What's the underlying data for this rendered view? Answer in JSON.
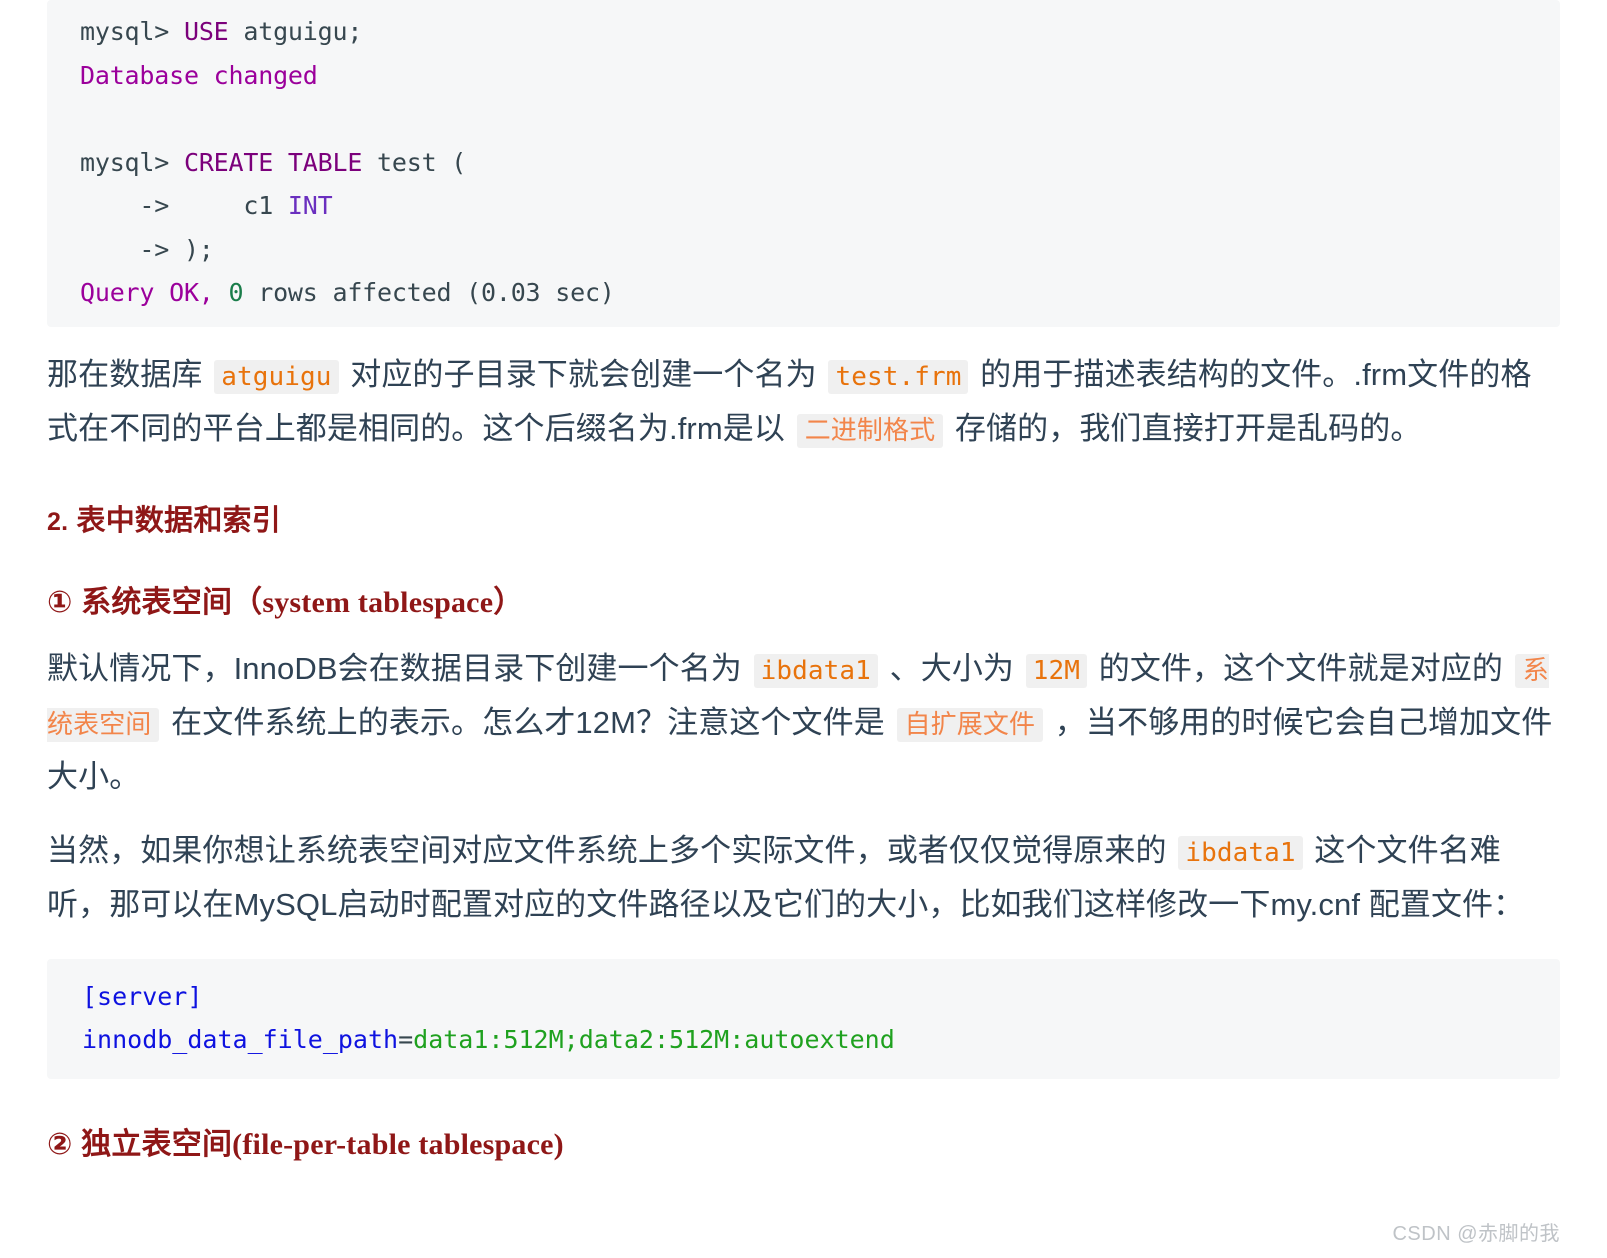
{
  "code_block_sql": {
    "lines": [
      [
        {
          "t": "mysql> ",
          "c": "prompt"
        },
        {
          "t": "USE",
          "c": "kw"
        },
        {
          "t": " atguigu;",
          "c": "plain"
        }
      ],
      [
        {
          "t": "Database changed",
          "c": "magenta"
        }
      ],
      [
        {
          "t": "",
          "c": "plain"
        }
      ],
      [
        {
          "t": "mysql> ",
          "c": "prompt"
        },
        {
          "t": "CREATE TABLE",
          "c": "kw"
        },
        {
          "t": " test (",
          "c": "plain"
        }
      ],
      [
        {
          "t": "    ->     c1 ",
          "c": "plain"
        },
        {
          "t": "INT",
          "c": "type"
        }
      ],
      [
        {
          "t": "    -> );",
          "c": "plain"
        }
      ],
      [
        {
          "t": "Query OK, ",
          "c": "magenta"
        },
        {
          "t": "0",
          "c": "num"
        },
        {
          "t": " rows affected (0.03 sec)",
          "c": "plain"
        }
      ]
    ]
  },
  "paragraph_frm": {
    "segments": [
      {
        "t": "那在数据库 ",
        "k": "text"
      },
      {
        "t": "atguigu",
        "k": "code"
      },
      {
        "t": " 对应的子目录下就会创建一个名为 ",
        "k": "text"
      },
      {
        "t": "test.frm",
        "k": "code"
      },
      {
        "t": " 的用于描述表结构的文件。.frm文件的格式在不同的平台上都是相同的。这个后缀名为.frm是以 ",
        "k": "text"
      },
      {
        "t": "二进制格式",
        "k": "code-cjk"
      },
      {
        "t": " 存储的，我们直接打开是乱码的。",
        "k": "text"
      }
    ]
  },
  "heading_section": {
    "num": "2.",
    "title": "表中数据和索引"
  },
  "heading_sub1": {
    "marker": "①",
    "cn": "系统表空间",
    "en": "（system tablespace）"
  },
  "paragraph_sys_tablespace": {
    "segments": [
      {
        "t": "默认情况下，InnoDB会在数据目录下创建一个名为 ",
        "k": "text"
      },
      {
        "t": "ibdata1",
        "k": "code"
      },
      {
        "t": " 、大小为 ",
        "k": "text"
      },
      {
        "t": "12M",
        "k": "code"
      },
      {
        "t": " 的文件，这个文件就是对应的 ",
        "k": "text"
      },
      {
        "t": "系统表空间",
        "k": "code-cjk"
      },
      {
        "t": " 在文件系统上的表示。怎么才12M？注意这个文件是 ",
        "k": "text"
      },
      {
        "t": "自扩展文件",
        "k": "code-cjk"
      },
      {
        "t": " ，当不够用的时候它会自己增加文件大小。",
        "k": "text"
      }
    ]
  },
  "paragraph_mycnf": {
    "segments": [
      {
        "t": "当然，如果你想让系统表空间对应文件系统上多个实际文件，或者仅仅觉得原来的 ",
        "k": "text"
      },
      {
        "t": "ibdata1",
        "k": "code"
      },
      {
        "t": " 这个文件名难听，那可以在MySQL启动时配置对应的文件路径以及它们的大小，比如我们这样修改一下my.cnf 配置文件：",
        "k": "text"
      }
    ]
  },
  "code_block_cnf": {
    "lines": [
      [
        {
          "t": "[server]",
          "c": "blue"
        }
      ],
      [
        {
          "t": "innodb_data_file_path",
          "c": "blue"
        },
        {
          "t": "=",
          "c": "eq"
        },
        {
          "t": "data1:512M;data2:512M:autoextend",
          "c": "green"
        }
      ]
    ]
  },
  "heading_sub2": {
    "marker": "②",
    "cn": "独立表空间",
    "en": "(file-per-table tablespace)"
  },
  "watermark": {
    "text": "CSDN @赤脚的我"
  },
  "colors": {
    "heading": "#8f1717",
    "body_text": "#2f4254",
    "inline_code": "#e8730c",
    "inline_code_cjk": "#f2854a",
    "code_bg": "#f6f7f8",
    "keyword": "#7b007b",
    "type": "#6a2fbf",
    "number": "#1a7d4a",
    "cnf_key": "#0e12e0",
    "cnf_value": "#1fa11f",
    "watermark": "#bfc3c7"
  }
}
